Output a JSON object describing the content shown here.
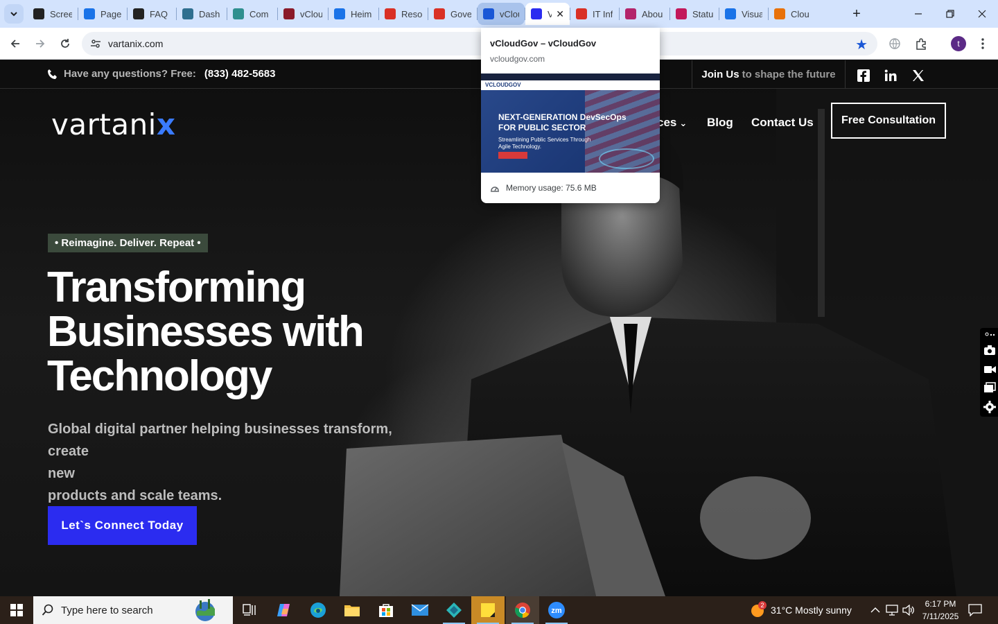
{
  "browser": {
    "tabs": [
      {
        "label": "Scree",
        "fav_color": "#222222",
        "fav_glyph": "gear-icon"
      },
      {
        "label": "Page",
        "fav_color": "#1a73e8",
        "fav_glyph": "speed-icon"
      },
      {
        "label": "FAQ",
        "fav_color": "#222222",
        "fav_glyph": "openai-icon"
      },
      {
        "label": "Dash",
        "fav_color": "#2f6f8f",
        "fav_glyph": "hexagon-icon"
      },
      {
        "label": "Com",
        "fav_color": "#2f8f8f",
        "fav_glyph": "hexagon-icon"
      },
      {
        "label": "vClou",
        "fav_color": "#8a1a2a",
        "fav_glyph": "v-icon"
      },
      {
        "label": "Heim",
        "fav_color": "#1a73e8",
        "fav_glyph": "scale-icon"
      },
      {
        "label": "Reso",
        "fav_color": "#d93025",
        "fav_glyph": "gem-icon"
      },
      {
        "label": "Gove",
        "fav_color": "#d93025",
        "fav_glyph": "gem-icon"
      },
      {
        "label": "vClou",
        "fav_color": "#1a57d6",
        "fav_glyph": "check-icon"
      },
      {
        "label": "V",
        "fav_color": "#2b2cf0",
        "fav_glyph": "x-logo-icon"
      },
      {
        "label": "IT Inf",
        "fav_color": "#d93025",
        "fav_glyph": "gem-icon"
      },
      {
        "label": "Abou",
        "fav_color": "#b3246b",
        "fav_glyph": "gem-icon"
      },
      {
        "label": "Statu",
        "fav_color": "#c2185b",
        "fav_glyph": "bolt-icon"
      },
      {
        "label": "Visua",
        "fav_color": "#1a73e8",
        "fav_glyph": "pulse-icon"
      },
      {
        "label": "Clou",
        "fav_color": "#e8710a",
        "fav_glyph": "swoosh-icon"
      }
    ],
    "address": "vartanix.com",
    "profile_initial": "t",
    "hovercard": {
      "title": "vCloudGov – vCloudGov",
      "domain": "vcloudgov.com",
      "memory": "Memory usage: 75.6 MB",
      "thumb_logo": "VCLOUDGOV",
      "thumb_headline": "NEXT-GENERATION DevSecOps FOR PUBLIC SECTOR",
      "thumb_sub": "Streamlining Public Services Through Agile Technology."
    }
  },
  "site": {
    "topbar": {
      "question": "Have any questions? Free:",
      "phone": "(833) 482-5683",
      "join_a": "Join Us",
      "join_b": "to shape the future"
    },
    "logo": {
      "main": "vartani",
      "accent": "x"
    },
    "menu": {
      "services_partial": "ces",
      "blog": "Blog",
      "contact": "Contact Us",
      "cta": "Free Consultation"
    },
    "hero": {
      "badge": "• Reimagine. Deliver. Repeat •",
      "headline_1": "Transforming",
      "headline_2": "Businesses with",
      "headline_3": "Technology",
      "sub_1": "Global digital partner helping businesses transform, create",
      "sub_2": "new",
      "sub_3": "products and scale teams.",
      "cta": "Let`s Connect Today"
    }
  },
  "taskbar": {
    "search_placeholder": "Type here to search",
    "weather_badge": "2",
    "weather": "31°C  Mostly sunny",
    "time": "6:17 PM",
    "date": "7/11/2025"
  }
}
